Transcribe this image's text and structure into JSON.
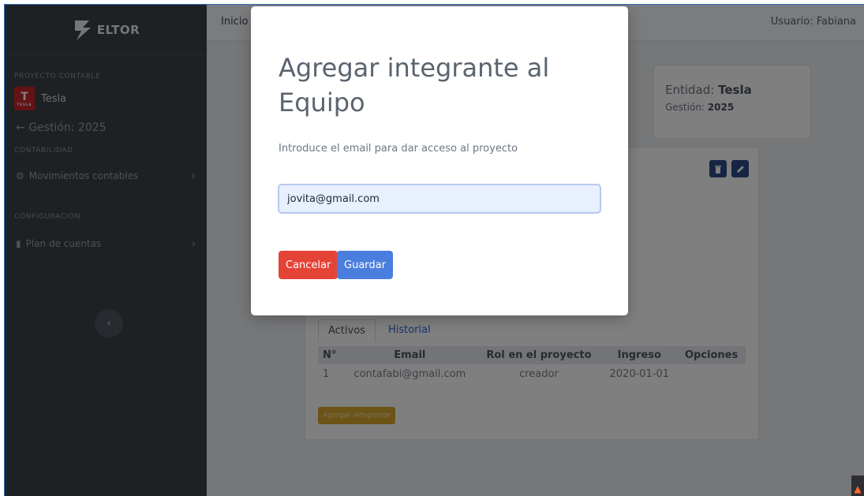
{
  "app": {
    "brand": "ELTOR"
  },
  "sidebar": {
    "project_heading": "PROYECTO CONTABLE",
    "project_name": "Tesla",
    "project_logo_caption": "TESLA",
    "gestion_link": "Gestión: 2025",
    "accounting_heading": "CONTABILIDAD",
    "accounting_item": "Movimientos contables",
    "config_heading": "CONFIGURACIÓN",
    "config_item": "Plan de cuentas"
  },
  "topbar": {
    "home": "Inicio",
    "user": "Usuario: Fabiana"
  },
  "entity_card": {
    "entity_label": "Entidad:",
    "entity_value": "Tesla",
    "gestion_label": "Gestión:",
    "gestion_value": "2025"
  },
  "team": {
    "tabs": [
      "Activos",
      "Historial"
    ],
    "columns": [
      "N°",
      "Email",
      "Rol en el proyecto",
      "Ingreso",
      "Opciones"
    ],
    "rows": [
      {
        "n": "1",
        "email": "contafabi@gmail.com",
        "rol": "creador",
        "ingreso": "2020-01-01",
        "opciones": ""
      }
    ],
    "add_button": "Agregar integrante"
  },
  "modal": {
    "title": "Agregar integrante al Equipo",
    "description": "Introduce el email para dar acceso al proyecto",
    "email_value": "jovita@gmail.com",
    "cancel_label": "Cancelar",
    "save_label": "Guardar"
  },
  "colors": {
    "sidebar_bg": "#3d4249",
    "cancel": "#e54336",
    "save": "#4a7ede",
    "add_member": "#d9a72c",
    "tesla_red": "#c8242b"
  }
}
